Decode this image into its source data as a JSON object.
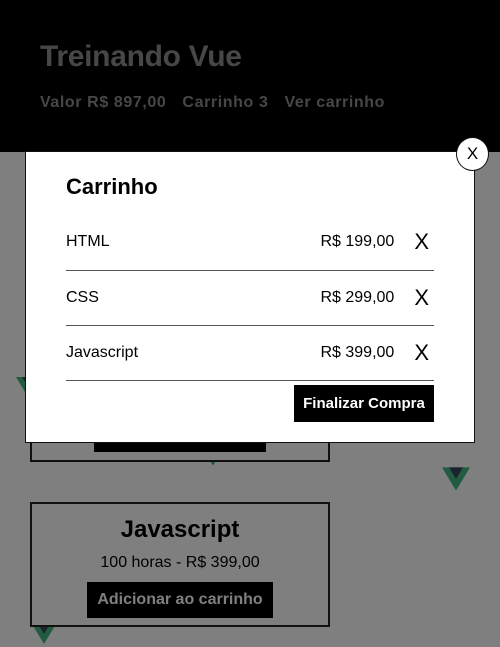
{
  "header": {
    "title": "Treinando Vue",
    "value_label": "Valor R$ 897,00",
    "cart_count_label": "Carrinho 3",
    "view_cart_label": "Ver carrinho"
  },
  "products": [
    {
      "name": "Javascript",
      "info": "100 horas - R$ 399,00",
      "add_label": "Adicionar ao carrinho"
    }
  ],
  "modal": {
    "title": "Carrinho",
    "close_label": "X",
    "items": [
      {
        "name": "HTML",
        "price": "R$ 199,00",
        "remove": "X"
      },
      {
        "name": "CSS",
        "price": "R$ 299,00",
        "remove": "X"
      },
      {
        "name": "Javascript",
        "price": "R$ 399,00",
        "remove": "X"
      }
    ],
    "finalize_label": "Finalizar Compra"
  },
  "colors": {
    "header_bg": "#000000",
    "header_text": "#8f8f8f",
    "overlay": "rgba(0,0,0,0.5)",
    "vue_green": "#42b883",
    "vue_dark": "#35495e"
  },
  "icons": {
    "logo": "vue-logo-icon"
  }
}
